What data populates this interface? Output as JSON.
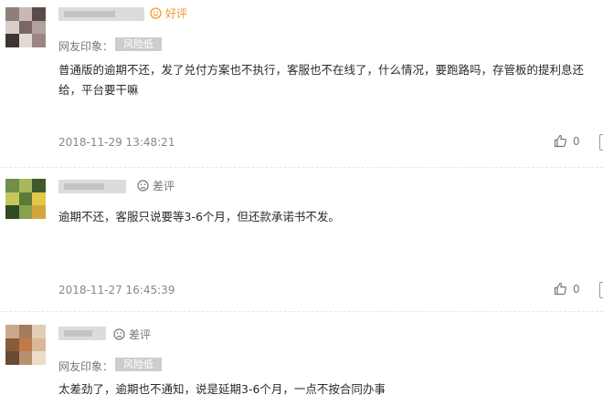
{
  "reviews": [
    {
      "rating_label": "好评",
      "rating_type": "good",
      "impression_label": "网友印象：",
      "impression_tag": "风险低",
      "content": "普通版的逾期不还，发了兑付方案也不执行，客服也不在线了，什么情况，要跑路吗，存管板的提利息还给，平台要干嘛",
      "timestamp": "2018-11-29 13:48:21",
      "likes": "0",
      "avatar_colors": [
        "#8e7f7b",
        "#c9b8b3",
        "#5a4b4a",
        "#d8cfcb",
        "#7b6663",
        "#b3a19c",
        "#3f3434",
        "#e3dad6",
        "#9a8682"
      ]
    },
    {
      "rating_label": "差评",
      "rating_type": "bad",
      "content": "逾期不还，客服只说要等3-6个月，但还款承诺书不发。",
      "timestamp": "2018-11-27 16:45:39",
      "likes": "0",
      "avatar_colors": [
        "#6f8f4a",
        "#a7b85a",
        "#3e5a2a",
        "#c6c65c",
        "#5b7a3a",
        "#e0c84a",
        "#2f4a24",
        "#8aa04c",
        "#d4a63a"
      ]
    },
    {
      "rating_label": "差评",
      "rating_type": "bad",
      "impression_label": "网友印象：",
      "impression_tag": "风险低",
      "content": "太差劲了，逾期也不通知，说是延期3-6个月，一点不按合同办事",
      "avatar_colors": [
        "#c9a98a",
        "#a47c5c",
        "#e2cdb6",
        "#8a5a3c",
        "#c07a4a",
        "#d8b898",
        "#6a4a34",
        "#b8906c",
        "#ecdcc8"
      ]
    }
  ],
  "icons": {
    "rating_good": "smile-face-icon",
    "rating_bad": "frown-face-icon",
    "like": "thumbs-up-icon",
    "more": "more-icon"
  },
  "colors": {
    "good": "#f39a2b",
    "bad": "#777777",
    "tag_bg": "#cdcdcd"
  }
}
